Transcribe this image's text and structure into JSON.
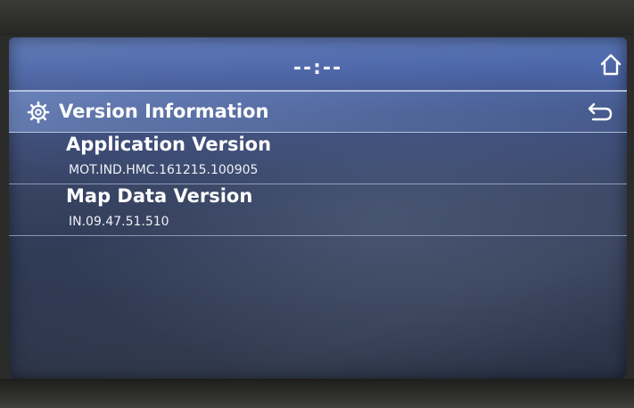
{
  "status_bar": {
    "clock": "--:--",
    "home_icon": "home-icon"
  },
  "header": {
    "title": "Version Information",
    "settings_icon": "gear-icon",
    "back_icon": "back-arrow-icon"
  },
  "items": [
    {
      "label": "Application Version",
      "value": "MOT.IND.HMC.161215.100905"
    },
    {
      "label": "Map Data Version",
      "value": "IN.09.47.51.510"
    }
  ],
  "colors": {
    "text": "#ffffff",
    "title_bar": "#6f8cc8",
    "screen_background": "#34405f"
  }
}
